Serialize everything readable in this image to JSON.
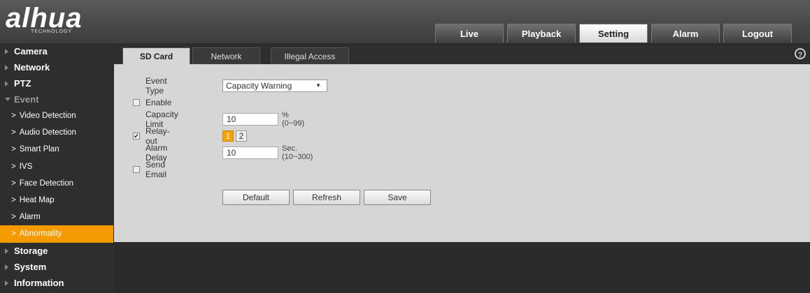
{
  "logo": {
    "text": "alhua",
    "subtext": "TECHNOLOGY"
  },
  "topnav": [
    "Live",
    "Playback",
    "Setting",
    "Alarm",
    "Logout"
  ],
  "topnav_active": "Setting",
  "sidebar": {
    "items": [
      {
        "label": "Camera"
      },
      {
        "label": "Network"
      },
      {
        "label": "PTZ"
      },
      {
        "label": "Event",
        "expanded": true
      }
    ],
    "sub_items": [
      "Video Detection",
      "Audio Detection",
      "Smart Plan",
      "IVS",
      "Face Detection",
      "Heat Map",
      "Alarm",
      "Abnormality"
    ],
    "active_sub": "Abnormality",
    "after": [
      "Storage",
      "System",
      "Information"
    ]
  },
  "tabs": [
    "SD Card",
    "Network",
    "Illegal Access"
  ],
  "active_tab": "SD Card",
  "help_icon": "question-icon",
  "form": {
    "event_type_label": "Event Type",
    "event_type_value": "Capacity Warning",
    "enable_label": "Enable",
    "enable_checked": false,
    "capacity_limit_label": "Capacity Limit",
    "capacity_limit_value": "10",
    "capacity_limit_hint": "%(0~99)",
    "relay_out_label": "Relay-out",
    "relay_out_checked": true,
    "relay_buttons": [
      "1",
      "2"
    ],
    "alarm_delay_label": "Alarm Delay",
    "alarm_delay_value": "10",
    "alarm_delay_hint": "Sec. (10~300)",
    "send_email_label": "Send Email",
    "send_email_checked": false
  },
  "buttons": {
    "default": "Default",
    "refresh": "Refresh",
    "save": "Save"
  },
  "colors": {
    "accent": "#f59a00",
    "background": "#2b2b2b",
    "panel": "#d6d6d6"
  }
}
